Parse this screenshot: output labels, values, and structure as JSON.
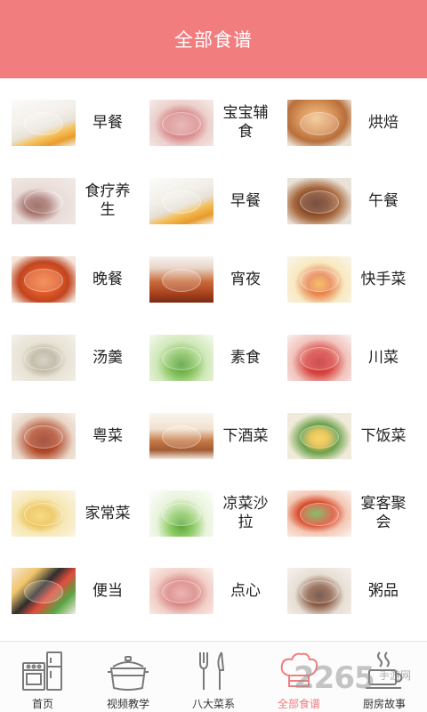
{
  "header": {
    "title": "全部食谱"
  },
  "categories": [
    {
      "label": "早餐",
      "thumb": "breakfast1"
    },
    {
      "label": "宝宝辅食",
      "thumb": "baby"
    },
    {
      "label": "烘焙",
      "thumb": "bake"
    },
    {
      "label": "食疗养生",
      "thumb": "diet"
    },
    {
      "label": "早餐",
      "thumb": "breakfast2"
    },
    {
      "label": "午餐",
      "thumb": "lunch"
    },
    {
      "label": "晚餐",
      "thumb": "dinner"
    },
    {
      "label": "宵夜",
      "thumb": "night"
    },
    {
      "label": "快手菜",
      "thumb": "quick"
    },
    {
      "label": "汤羹",
      "thumb": "soup"
    },
    {
      "label": "素食",
      "thumb": "veg"
    },
    {
      "label": "川菜",
      "thumb": "sichuan"
    },
    {
      "label": "粤菜",
      "thumb": "canton"
    },
    {
      "label": "下酒菜",
      "thumb": "wine"
    },
    {
      "label": "下饭菜",
      "thumb": "rice"
    },
    {
      "label": "家常菜",
      "thumb": "home"
    },
    {
      "label": "凉菜沙拉",
      "thumb": "cold"
    },
    {
      "label": "宴客聚会",
      "thumb": "feast"
    },
    {
      "label": "便当",
      "thumb": "bento"
    },
    {
      "label": "点心",
      "thumb": "snack"
    },
    {
      "label": "粥品",
      "thumb": "porridge"
    }
  ],
  "tabbar": {
    "items": [
      {
        "label": "首页",
        "icon": "kitchen-icon",
        "active": false
      },
      {
        "label": "视频教学",
        "icon": "pot-icon",
        "active": false
      },
      {
        "label": "八大菜系",
        "icon": "cutlery-icon",
        "active": false
      },
      {
        "label": "全部食谱",
        "icon": "chef-hat-icon",
        "active": true
      },
      {
        "label": "厨房故事",
        "icon": "coffee-cup-icon",
        "active": false
      }
    ]
  },
  "watermark": {
    "number": "2265",
    "text": "手游网"
  },
  "colors": {
    "accent": "#f27d7f",
    "icon_gray": "#7a7a7a"
  }
}
